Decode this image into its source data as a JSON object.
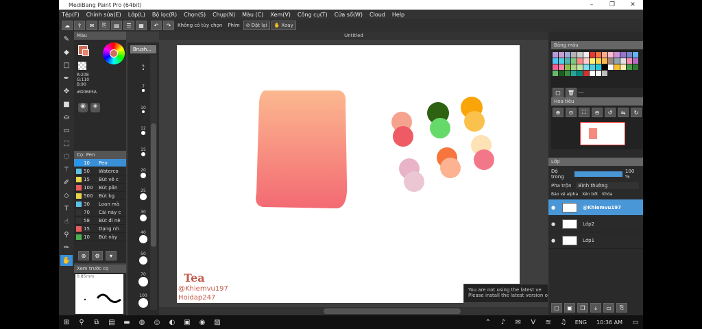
{
  "window": {
    "title": "MediBang Paint Pro (64bit)"
  },
  "menu": [
    "Tệp(F)",
    "Chỉnh sửa(E)",
    "Lớp(L)",
    "Bộ lọc(R)",
    "Chọn(S)",
    "Chụp(N)",
    "Màu (C)",
    "Xem(V)",
    "Công cụ(T)",
    "Cửa sổ(W)",
    "Cloud",
    "Help"
  ],
  "toolbar": {
    "hand_mode": "Không có tùy chọn",
    "keys_label": "Phím",
    "reset_label": "Đặt lại",
    "rotate_label": "Xoay"
  },
  "canvas": {
    "title": "Untitled",
    "sig_logo": "Tea",
    "sig_line1": "@Khiemvu197",
    "sig_line2": "Hoidap247"
  },
  "color_panel": {
    "title": "Màu",
    "r": "R:208",
    "g": "G:110",
    "b": "B:90",
    "hex": "#D06E5A",
    "main_color": "#D06E5A"
  },
  "brush_panel": {
    "title": "Cọ: Pen",
    "items": [
      {
        "size": "10",
        "name": "Pen",
        "color": "#2196f3"
      },
      {
        "size": "50",
        "name": "Waterco",
        "color": "#5bc0eb"
      },
      {
        "size": "15",
        "name": "Bút vẽ c",
        "color": "#e8d44d"
      },
      {
        "size": "100",
        "name": "Bút pấn",
        "color": "#e85d5d"
      },
      {
        "size": "500",
        "name": "Bút bg",
        "color": "#e8d44d"
      },
      {
        "size": "30",
        "name": "Loan mà",
        "color": "#5bc0eb"
      },
      {
        "size": "70",
        "name": "Cái này c",
        "color": "#333333"
      },
      {
        "size": "58",
        "name": "Bút đi nè",
        "color": "#333333"
      },
      {
        "size": "15",
        "name": "Dạng nh",
        "color": "#e85d5d"
      },
      {
        "size": "10",
        "name": "Bút này",
        "color": "#4caf50"
      }
    ]
  },
  "preview_panel": {
    "title": "Xem trước cọ",
    "size": "0.85mm"
  },
  "size_panel": {
    "title": "Brush...",
    "sizes": [
      "5",
      "7",
      "10",
      "12",
      "15",
      "20",
      "25",
      "30",
      "40",
      "50",
      "70",
      "100"
    ]
  },
  "palette_panel": {
    "title": "Bảng màu",
    "colors": [
      "#b49bd8",
      "#c8a0d0",
      "#9fa8da",
      "#b3b3b3",
      "#cccccc",
      "#eeeeee",
      "#e53935",
      "#ff7043",
      "#ffab91",
      "#f8bbd0",
      "#ce93d8",
      "#9575cd",
      "#7986cb",
      "#64b5f6",
      "#4fc3f7",
      "#4dd0e1",
      "#4db6ac",
      "#81c784",
      "#ff8a80",
      "#ffcdd2",
      "#fff176",
      "#ffd54f",
      "#ffb74d",
      "#a1887f",
      "#90a4ae",
      "#e0e0e0",
      "#f48fb1",
      "#ba68c8",
      "#f06292",
      "#ff80ab",
      "#8bc34a",
      "#aed581",
      "#c5e1a5",
      "#80deea",
      "#4dd0e1",
      "#26c6da",
      "#000000",
      "#ffffff",
      "#fbc02d",
      "#ffecb3",
      "#43a047",
      "#2e7d32",
      "#66bb6a",
      "#1b5e20",
      "#388e3c",
      "#26a69a",
      "#00897b",
      "#d32f2f",
      "#ffffff",
      "#f5f5f5",
      "#bdbdbd"
    ],
    "extra": "---"
  },
  "navigator_panel": {
    "title": "Hoa tiêu"
  },
  "layer_panel": {
    "title": "Lớp",
    "opacity_label": "Độ trong",
    "opacity_value": "100 %",
    "blend_label": "Pha trộn",
    "blend_value": "Bình thường",
    "protect_alpha": "Bảo vệ alpha",
    "clipping": "Xén bớt",
    "lock": "Khóa",
    "layers": [
      "@Khiemvu197",
      "Lớp2",
      "Lớp1"
    ]
  },
  "notice": {
    "line1": "You are not using the latest ve",
    "line2": "Please install the latest version of"
  },
  "taskbar": {
    "lang": "ENG",
    "time": "10:36 AM"
  }
}
